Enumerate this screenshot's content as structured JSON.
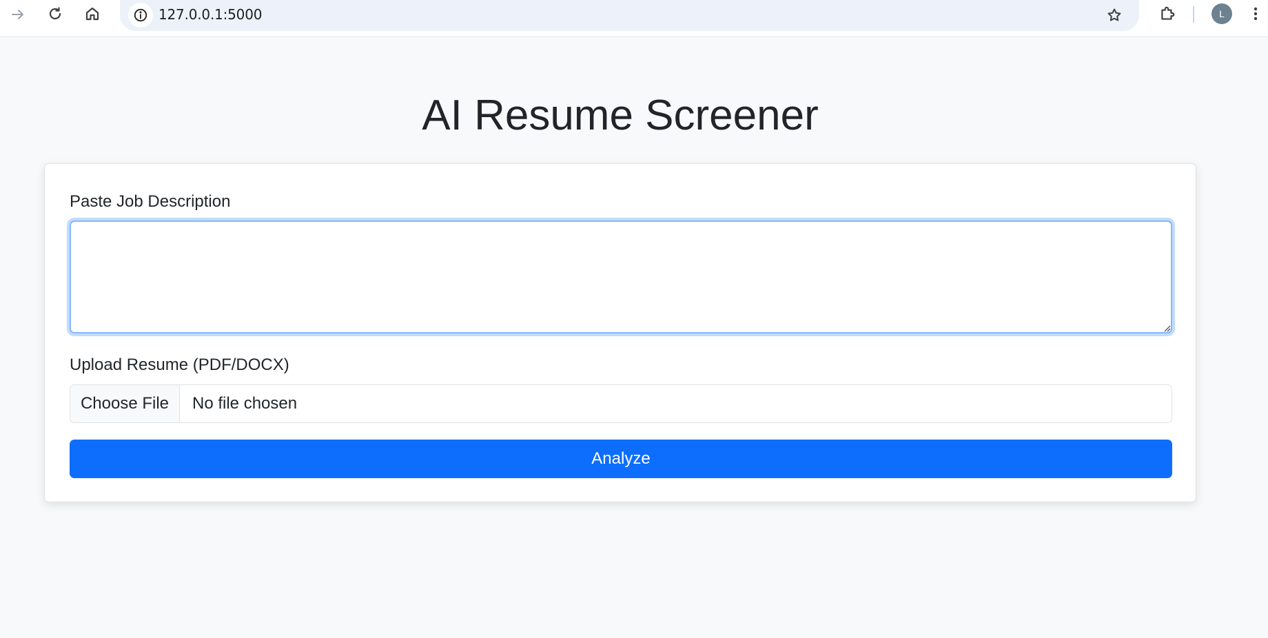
{
  "browser": {
    "url": "127.0.0.1:5000",
    "profile_initial": "L",
    "icons": {
      "forward": "arrow-right-icon",
      "reload": "reload-icon",
      "home": "home-icon",
      "site_info": "info-icon",
      "bookmark": "star-icon",
      "extensions": "puzzle-icon",
      "menu": "kebab-menu-icon"
    }
  },
  "page": {
    "title": "AI Resume Screener",
    "form": {
      "job_description_label": "Paste Job Description",
      "job_description_value": "",
      "resume_label": "Upload Resume (PDF/DOCX)",
      "file_button_label": "Choose File",
      "file_status": "No file chosen",
      "submit_label": "Analyze"
    }
  },
  "colors": {
    "page_background": "#f8f9fa",
    "primary": "#0d6efd",
    "focus_ring": "#86b7fe",
    "text": "#212529"
  }
}
